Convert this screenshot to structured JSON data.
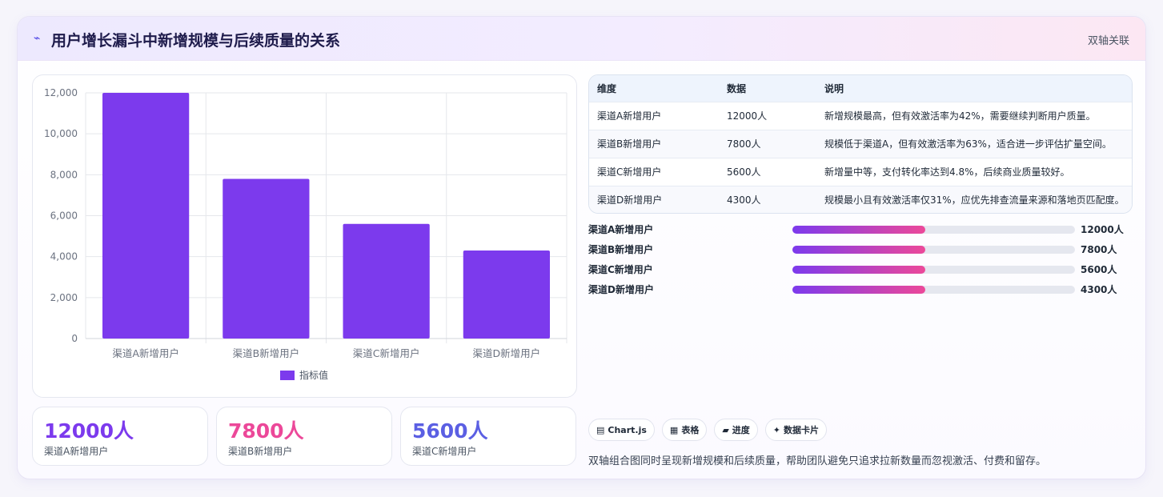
{
  "header": {
    "icon": "chart-line-icon",
    "title": "用户增长漏斗中新增规模与后续质量的关系",
    "tag": "双轴关联"
  },
  "chart_data": {
    "type": "bar",
    "categories": [
      "渠道A新增用户",
      "渠道B新增用户",
      "渠道C新增用户",
      "渠道D新增用户"
    ],
    "series": [
      {
        "name": "指标值",
        "values": [
          12000,
          7800,
          5600,
          4300
        ],
        "color": "#7c3aed"
      }
    ],
    "ylim": [
      0,
      12000
    ],
    "yticks": [
      "0",
      "2,000",
      "4,000",
      "6,000",
      "8,000",
      "10,000",
      "12,000"
    ],
    "grid": true,
    "legend": "bottom"
  },
  "stats": [
    {
      "value": "12000人",
      "label": "渠道A新增用户",
      "color": "#7c3aed"
    },
    {
      "value": "7800人",
      "label": "渠道B新增用户",
      "color": "#ec4899"
    },
    {
      "value": "5600人",
      "label": "渠道C新增用户",
      "color": "#5b5fe3"
    }
  ],
  "table": {
    "headers": [
      "维度",
      "数据",
      "说明"
    ],
    "rows": [
      [
        "渠道A新增用户",
        "12000人",
        "新增规模最高，但有效激活率为42%，需要继续判断用户质量。"
      ],
      [
        "渠道B新增用户",
        "7800人",
        "规模低于渠道A，但有效激活率为63%，适合进一步评估扩量空间。"
      ],
      [
        "渠道C新增用户",
        "5600人",
        "新增量中等，支付转化率达到4.8%，后续商业质量较好。"
      ],
      [
        "渠道D新增用户",
        "4300人",
        "规模最小且有效激活率仅31%，应优先排查流量来源和落地页匹配度。"
      ]
    ]
  },
  "progress": [
    {
      "label": "渠道A新增用户",
      "value": "12000人",
      "fraction": 0.47
    },
    {
      "label": "渠道B新增用户",
      "value": "7800人",
      "fraction": 0.47
    },
    {
      "label": "渠道C新增用户",
      "value": "5600人",
      "fraction": 0.47
    },
    {
      "label": "渠道D新增用户",
      "value": "4300人",
      "fraction": 0.47
    }
  ],
  "chips": [
    {
      "icon": "▤",
      "label": "Chart.js"
    },
    {
      "icon": "▦",
      "label": "表格"
    },
    {
      "icon": "▰",
      "label": "进度"
    },
    {
      "icon": "✦",
      "label": "数据卡片"
    }
  ],
  "note": "双轴组合图同时呈现新增规模和后续质量，帮助团队避免只追求拉新数量而忽视激活、付费和留存。"
}
